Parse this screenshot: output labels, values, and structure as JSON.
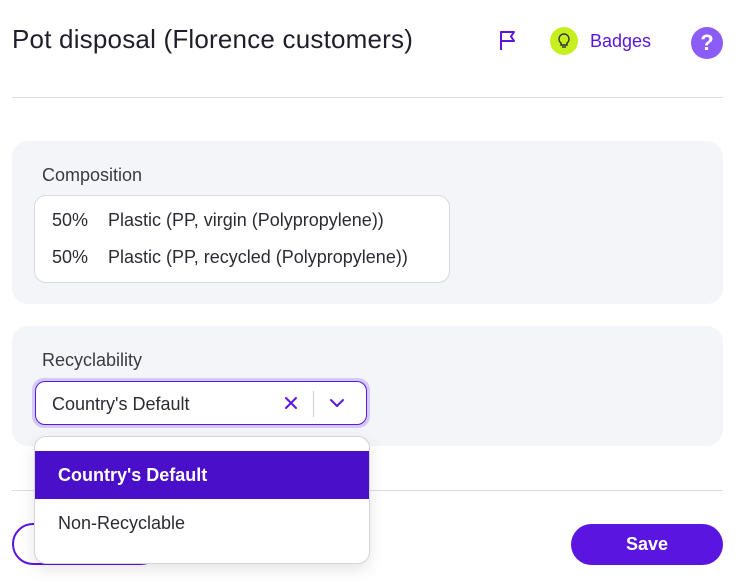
{
  "header": {
    "title": "Pot disposal (Florence customers)",
    "badges_label": "Badges",
    "help_glyph": "?",
    "icons": [
      "flag-icon",
      "lightbulb-icon",
      "help-icon"
    ]
  },
  "composition": {
    "label": "Composition",
    "rows": [
      {
        "percent": "50%",
        "material": "Plastic (PP, virgin (Polypropylene))"
      },
      {
        "percent": "50%",
        "material": "Plastic (PP, recycled (Polypropylene))"
      }
    ]
  },
  "recyclability": {
    "label": "Recyclability",
    "selected_value": "Country's Default",
    "options": [
      "Country's Default",
      "Non-Recyclable"
    ]
  },
  "footer": {
    "save_label": "Save"
  },
  "colors": {
    "accent": "#5a16e0",
    "selected_option_bg": "#4a0fc9",
    "bulb": "#c6ef1f",
    "help": "#8b5cf6",
    "panel_bg": "#f4f5f9"
  }
}
